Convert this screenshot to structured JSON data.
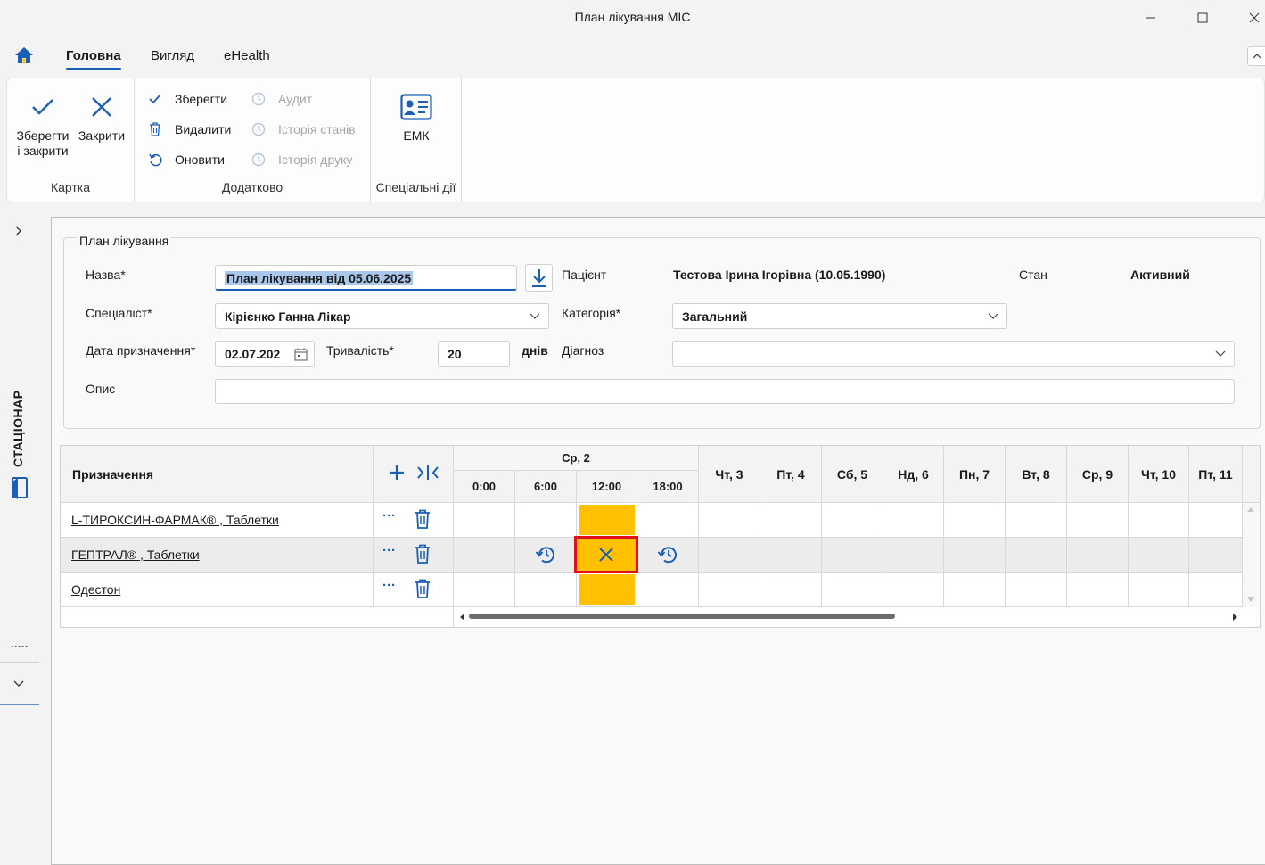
{
  "window": {
    "title": "План лікування МІС"
  },
  "tabs": [
    {
      "label": "Головна",
      "active": true
    },
    {
      "label": "Вигляд"
    },
    {
      "label": "eHealth"
    }
  ],
  "ribbon": {
    "card_group": {
      "label": "Картка",
      "save_close_label_line1": "Зберегти",
      "save_close_label_line2": "і закрити",
      "close_label": "Закрити"
    },
    "extra_group": {
      "label": "Додатково",
      "save": "Зберегти",
      "delete": "Видалити",
      "refresh": "Оновити",
      "audit": "Аудит",
      "state_history": "Історія станів",
      "print_history": "Історія друку"
    },
    "special_group": {
      "label": "Спеціальні дії",
      "emk": "ЕМК"
    }
  },
  "sidebar": {
    "vertical_label": "СТАЦІОНАР",
    "dots": "·····"
  },
  "form": {
    "legend": "План лікування",
    "name_label": "Назва*",
    "name_value": "План лікування від 05.06.2025",
    "patient_label": "Пацієнт",
    "patient_value": "Тестова Ірина Ігорівна (10.05.1990)",
    "state_label": "Стан",
    "state_value": "Активний",
    "specialist_label": "Спеціаліст*",
    "specialist_value": "Кірієнко Ганна Лікар",
    "category_label": "Категорія*",
    "category_value": "Загальний",
    "date_label": "Дата призначення*",
    "date_value": "02.07.202",
    "duration_label": "Тривалість*",
    "duration_value": "20",
    "duration_unit": "днів",
    "diagnosis_label": "Діагноз",
    "diagnosis_value": "",
    "description_label": "Опис",
    "description_value": ""
  },
  "grid": {
    "header_prescription": "Призначення",
    "day_main": "Ср, 2",
    "times": [
      "0:00",
      "6:00",
      "12:00",
      "18:00"
    ],
    "days": [
      "Чт, 3",
      "Пт, 4",
      "Сб, 5",
      "Нд, 6",
      "Пн, 7",
      "Вт, 8",
      "Ср, 9",
      "Чт, 10",
      "Пт, 11"
    ],
    "rows": [
      {
        "name": "L-ТИРОКСИН-ФАРМАК® , Таблетки"
      },
      {
        "name": "ГЕПТРАЛ® , Таблетки"
      },
      {
        "name": "Одестон"
      }
    ],
    "more_glyph": "···"
  },
  "colors": {
    "accent": "#1b5fb5",
    "highlight_yellow": "#ffc000",
    "selection_red": "#e0101a"
  }
}
